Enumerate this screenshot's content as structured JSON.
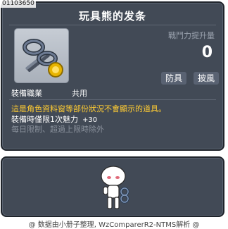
{
  "item": {
    "id": "01103650",
    "title": "玩具熊的发条"
  },
  "power": {
    "label": "戰鬥力提升量",
    "value": "0"
  },
  "tags": {
    "armor": "防具",
    "cape": "披風"
  },
  "job": {
    "label": "裝備職業",
    "value": "共用"
  },
  "description": {
    "warning": "這是角色資料窗等部份狀況不會顯示的道具。",
    "equip_bonus_label": "裝備時僅限1次魅力",
    "equip_bonus_value": "+30",
    "limit_line1": "每日限制、超過上限時除外"
  },
  "footer": {
    "text": "@ 数据由小册子整理, WzComparerR2-NTMS解析 @"
  },
  "colors": {
    "panel_bg": "#424a56",
    "warning": "#ffcc33",
    "muted": "#8a919c",
    "tag_bg": "#596272"
  },
  "icons": {
    "item_icon": "windup-key-icon",
    "preview": "character-preview"
  }
}
